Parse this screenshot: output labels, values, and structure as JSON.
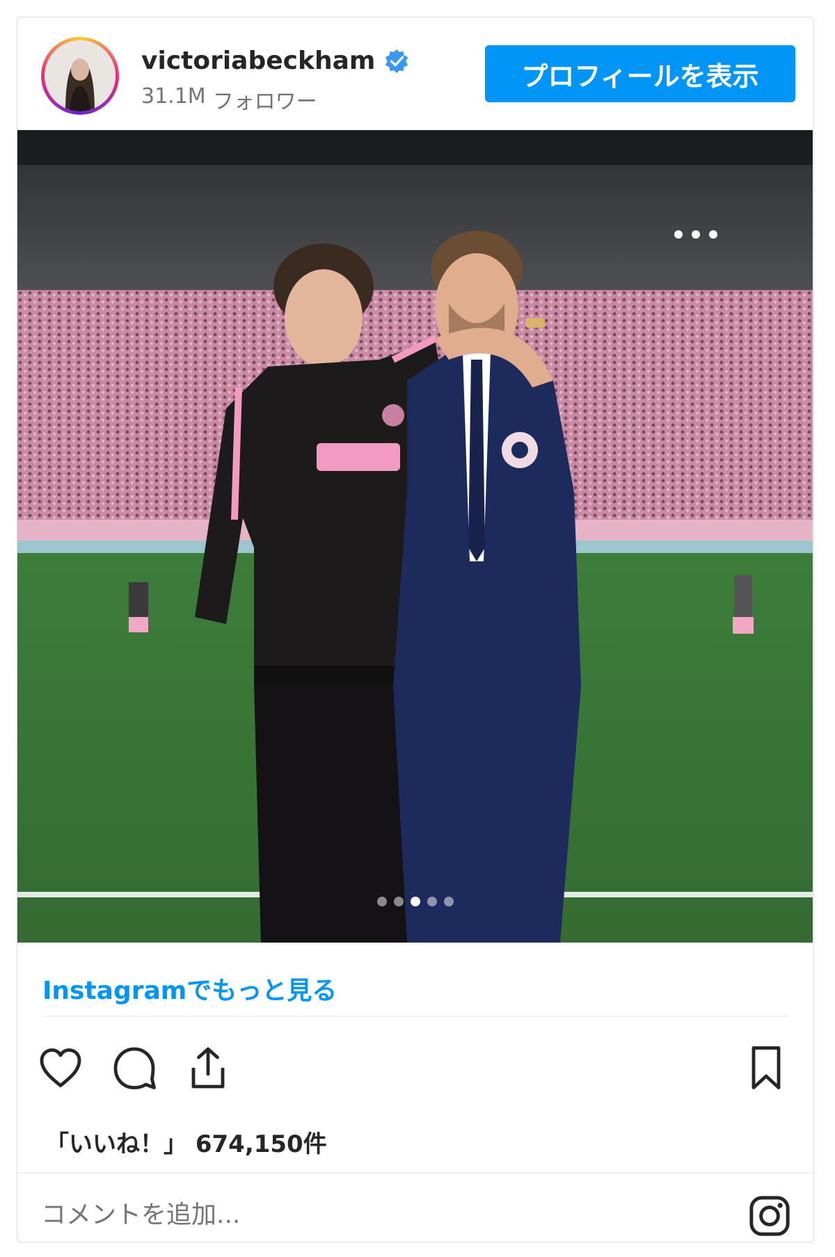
{
  "header": {
    "username": "victoriabeckham",
    "followers_count": "31.1M",
    "followers_label": "フォロワー",
    "profile_button": "プロフィールを表示"
  },
  "carousel": {
    "slide_count": 5,
    "active_index": 2
  },
  "footer": {
    "more_link": "Instagramでもっと見る",
    "likes_prefix": "「いいね！」",
    "likes_count": "674,150件",
    "comment_placeholder": "コメントを追加..."
  },
  "colors": {
    "accent": "#0095f6",
    "text": "#262626",
    "muted": "#737373"
  },
  "icons": [
    "verified-badge-icon",
    "heart-icon",
    "comment-icon",
    "share-icon",
    "bookmark-icon",
    "instagram-logo-icon"
  ]
}
